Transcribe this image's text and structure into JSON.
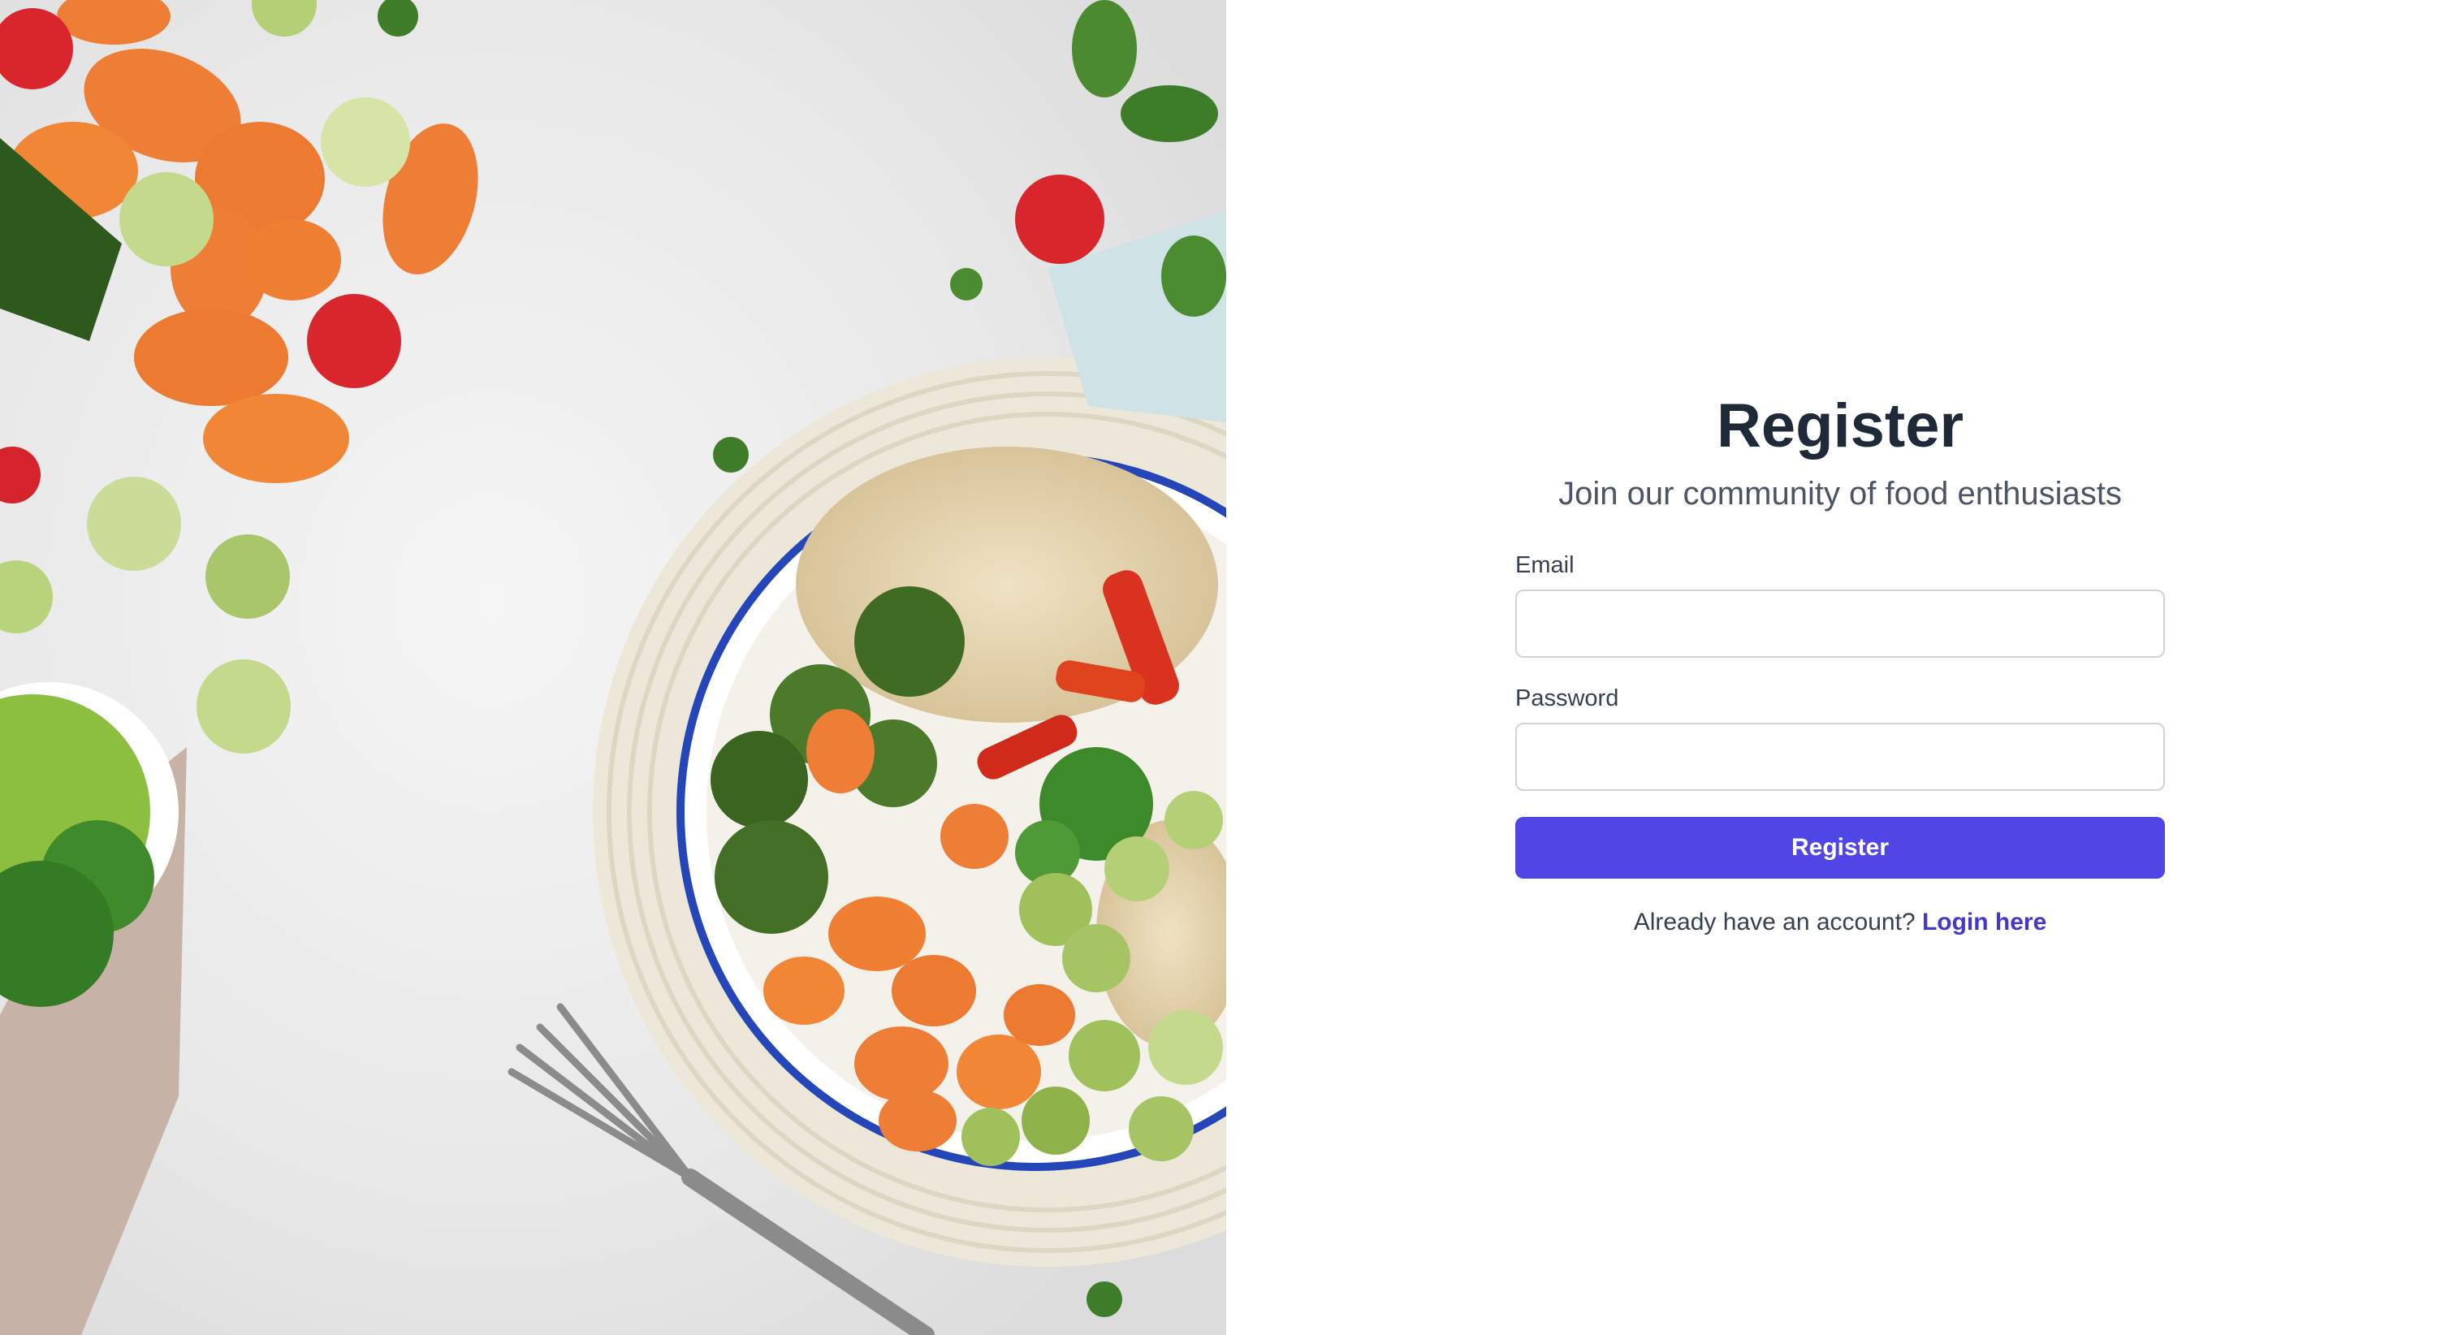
{
  "hero_image": {
    "icon": "food-bowl-photo",
    "colors": {
      "background": "#eaeaea",
      "carrot": "#ee7d36",
      "tomato": "#d9262c",
      "broccoli": "#3f6b22",
      "sprout": "#9fc05a",
      "plate_rim": "#2446b8"
    }
  },
  "form": {
    "title": "Register",
    "subtitle": "Join our community of food enthusiasts",
    "email_label": "Email",
    "email_value": "",
    "password_label": "Password",
    "password_value": "",
    "submit_label": "Register",
    "login_prompt": "Already have an account?",
    "login_link": "Login here"
  },
  "colors": {
    "accent": "#4f46e5",
    "link": "#4338ca",
    "title": "#1f2937",
    "text": "#374151"
  }
}
